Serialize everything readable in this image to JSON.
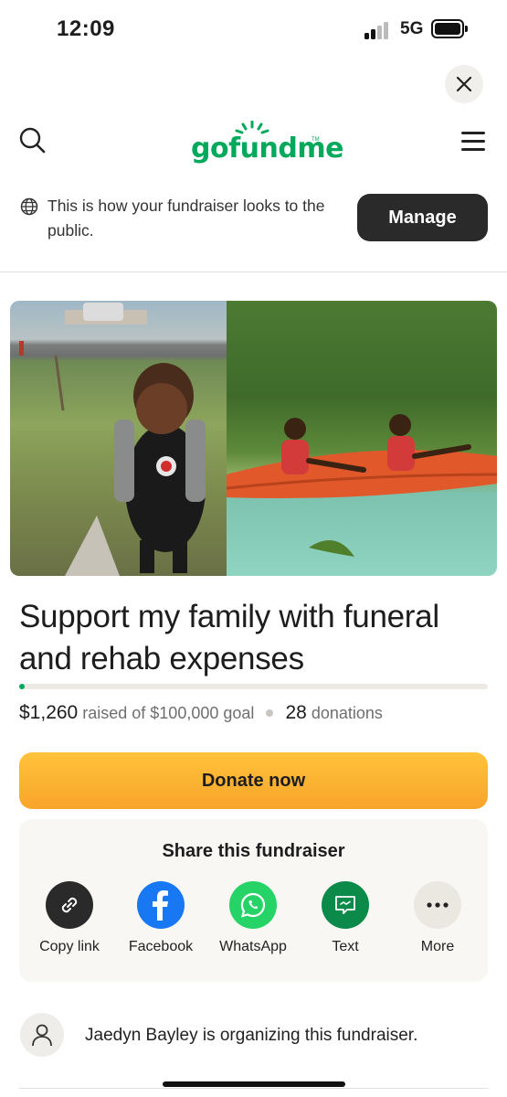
{
  "status_bar": {
    "time": "12:09",
    "network": "5G"
  },
  "header": {
    "logo_text": "gofundme",
    "logo_tm": "TM",
    "icons": {
      "search": "search-icon",
      "menu": "menu-icon",
      "close": "close-icon"
    }
  },
  "notice": {
    "text": "This is how your fundraiser looks to the public.",
    "manage_label": "Manage",
    "icon": "globe-icon"
  },
  "fundraiser": {
    "title": "Support my family with funeral and rehab expenses",
    "raised": "$1,260",
    "raised_of_text": "raised of $100,000 goal",
    "donations_count": "28",
    "donations_label": "donations",
    "progress_fraction": 0.0126,
    "donate_label": "Donate now"
  },
  "share": {
    "title": "Share this fundraiser",
    "items": [
      {
        "label": "Copy link",
        "icon": "link-icon",
        "color": "#2a2a2a"
      },
      {
        "label": "Facebook",
        "icon": "facebook-icon",
        "color": "#1877f2"
      },
      {
        "label": "WhatsApp",
        "icon": "whatsapp-icon",
        "color": "#25d366"
      },
      {
        "label": "Text",
        "icon": "message-icon",
        "color": "#0b8a4a"
      },
      {
        "label": "More",
        "icon": "more-icon",
        "color": "#ebe7e1"
      }
    ]
  },
  "organizer": {
    "text": "Jaedyn Bayley is organizing this fundraiser.",
    "icon": "person-icon"
  },
  "colors": {
    "brand_green": "#02a95c",
    "donate_orange": "#f8a42b",
    "manage_dark": "#2a2a2a"
  }
}
